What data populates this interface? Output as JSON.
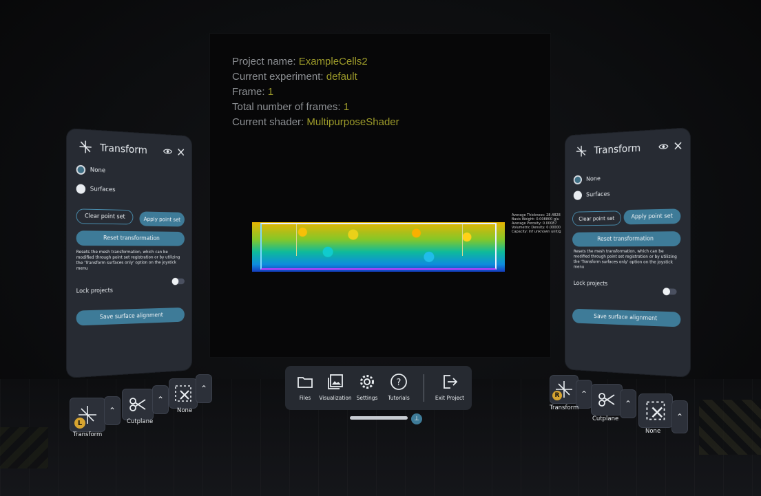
{
  "info": {
    "project_label": "Project name:",
    "project_value": "ExampleCells2",
    "experiment_label": "Current experiment:",
    "experiment_value": "default",
    "frame_label": "Frame:",
    "frame_value": "1",
    "total_label": "Total number of frames:",
    "total_value": "1",
    "shader_label": "Current shader:",
    "shader_value": "MultipurposeShader"
  },
  "viz_legend": [
    "Average Thickness: 28.4828",
    "Basis Weight: 0.008800 g/u",
    "Average Porosity: 0.00087",
    "Volumetric Density: 0.00000",
    "Capacity: Inf unknown unit/g"
  ],
  "left_panel": {
    "title": "Transform",
    "radio_none": "None",
    "radio_surfaces": "Surfaces",
    "clear_btn": "Clear point set",
    "apply_btn": "Apply point set",
    "reset_btn": "Reset transformation",
    "description": "Resets the mesh transformation, which can be modified through point set registration or by utilizing the 'Transform surfaces only' option on the joystick menu",
    "lock_label": "Lock projects",
    "save_btn": "Save surface alignment"
  },
  "right_panel": {
    "title": "Transform",
    "radio_none": "None",
    "radio_surfaces": "Surfaces",
    "clear_btn": "Clear point set",
    "apply_btn": "Apply point set",
    "reset_btn": "Reset transformation",
    "description": "Resets the mesh transformation, which can be modified through point set registration or by utilizing the 'Transform surfaces only' option on the joystick menu",
    "lock_label": "Lock projects",
    "save_btn": "Save surface alignment"
  },
  "left_tools": {
    "transform_label": "Transform",
    "transform_badge": "L",
    "cutplane_label": "Cutplane",
    "none_label": "None"
  },
  "right_tools": {
    "transform_label": "Transform",
    "transform_badge": "R",
    "cutplane_label": "Cutplane",
    "none_label": "None"
  },
  "dock": {
    "files": "Files",
    "visualization": "Visualization",
    "settings": "Settings",
    "tutorials": "Tutorials",
    "exit": "Exit Project"
  },
  "colors": {
    "accent": "#3e7b98",
    "panel": "#272b33",
    "info_value": "#9c9a2a",
    "info_label": "#8c8f93"
  }
}
